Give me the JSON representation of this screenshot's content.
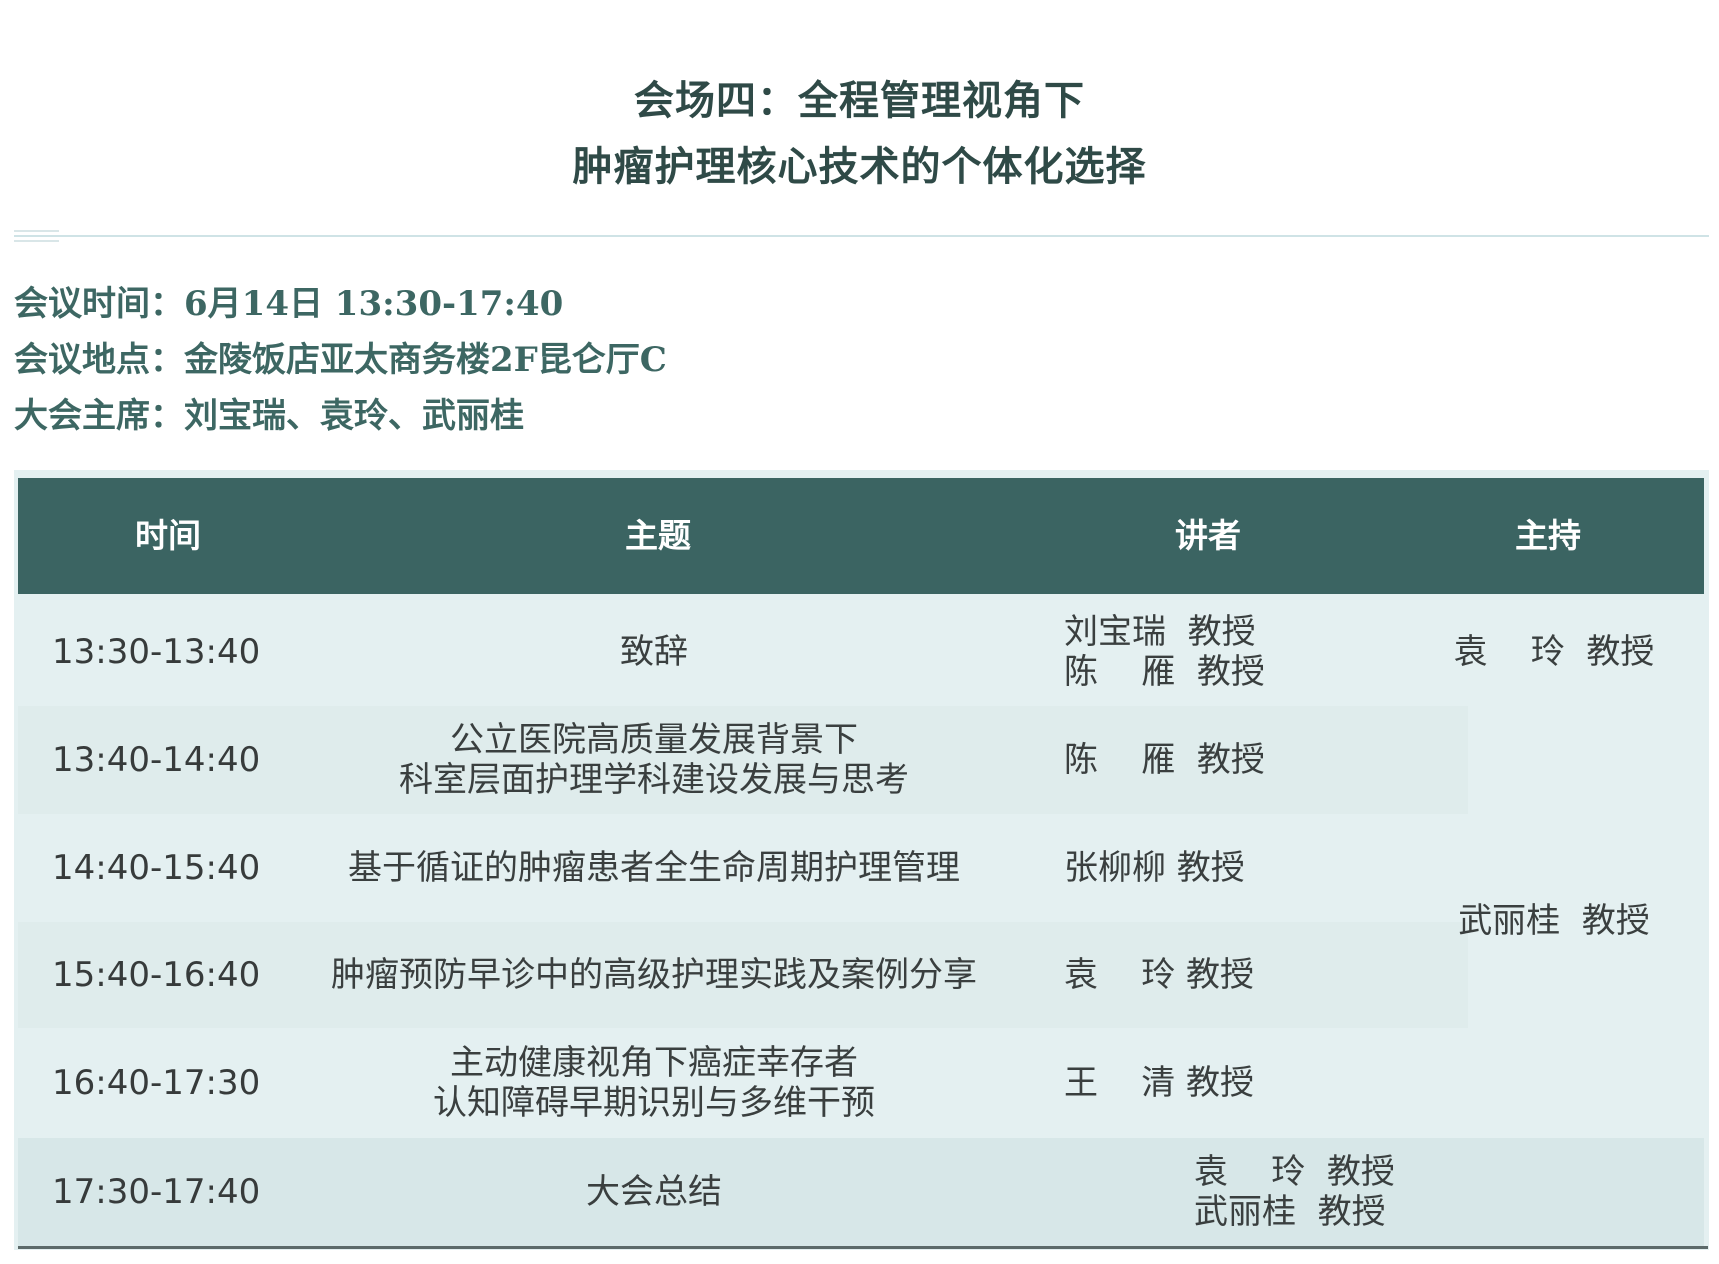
{
  "header": {
    "title_line1": "会场四：全程管理视角下",
    "title_line2": "肿瘤护理核心技术的个体化选择"
  },
  "info": {
    "time_label": "会议时间：",
    "time_value": "6月14日 13:30-17:40",
    "place_label": "会议地点：",
    "place_value": "金陵饭店亚太商务楼2F昆仑厅C",
    "chair_label": "大会主席：",
    "chair_value": "刘宝瑞、袁玲、武丽桂"
  },
  "table": {
    "headers": [
      "时间",
      "主题",
      "讲者",
      "主持"
    ],
    "rows": [
      {
        "time": "13:30-13:40",
        "topic": [
          "致辞"
        ],
        "speaker": [
          "刘宝瑞  教授",
          "陈    雁  教授"
        ]
      },
      {
        "time": "13:40-14:40",
        "topic": [
          "公立医院高质量发展背景下",
          "科室层面护理学科建设发展与思考"
        ],
        "speaker": [
          "陈    雁  教授"
        ]
      },
      {
        "time": "14:40-15:40",
        "topic": [
          "基于循证的肿瘤患者全生命周期护理管理"
        ],
        "speaker": [
          "张柳柳 教授"
        ]
      },
      {
        "time": "15:40-16:40",
        "topic": [
          "肿瘤预防早诊中的高级护理实践及案例分享"
        ],
        "speaker": [
          "袁    玲 教授"
        ]
      },
      {
        "time": "16:40-17:30",
        "topic": [
          "主动健康视角下癌症幸存者",
          "认知障碍早期识别与多维干预"
        ],
        "speaker": [
          "王    清 教授"
        ]
      },
      {
        "time": "17:30-17:40",
        "topic": [
          "大会总结"
        ],
        "speaker": [
          "袁    玲  教授",
          "武丽桂  教授"
        ]
      }
    ],
    "hosts": [
      "袁    玲  教授",
      "武丽桂  教授"
    ]
  },
  "colors": {
    "header_bg": "#3b6462",
    "table_bg": "#e4f0f1",
    "title_text": "#2f4a47",
    "info_text": "#3d6763"
  }
}
